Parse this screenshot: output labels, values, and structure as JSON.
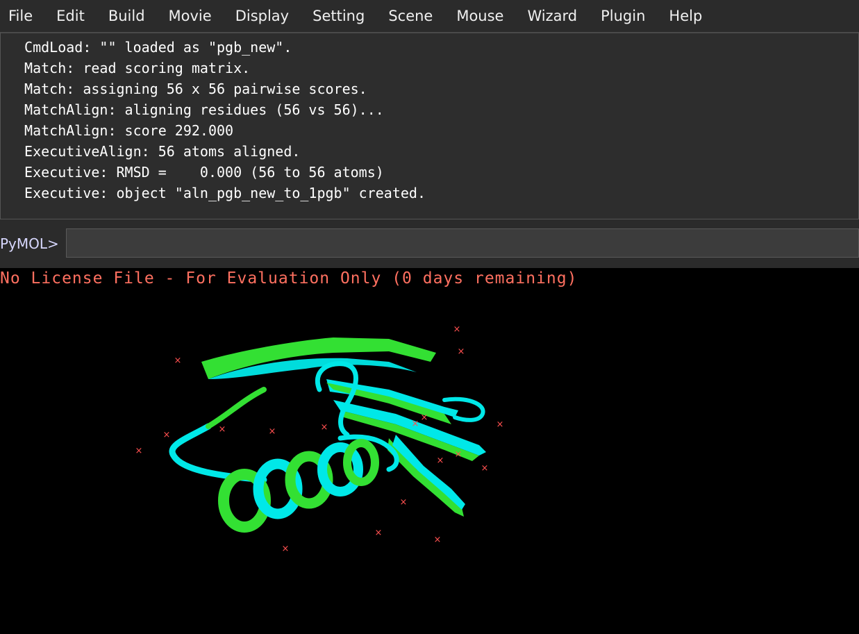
{
  "menubar": {
    "items": [
      {
        "label": "File"
      },
      {
        "label": "Edit"
      },
      {
        "label": "Build"
      },
      {
        "label": "Movie"
      },
      {
        "label": "Display"
      },
      {
        "label": "Setting"
      },
      {
        "label": "Scene"
      },
      {
        "label": "Mouse"
      },
      {
        "label": "Wizard"
      },
      {
        "label": "Plugin"
      },
      {
        "label": "Help"
      }
    ]
  },
  "console": {
    "lines": [
      " CmdLoad: \"\" loaded as \"pgb_new\".",
      " Match: read scoring matrix.",
      " Match: assigning 56 x 56 pairwise scores.",
      " MatchAlign: aligning residues (56 vs 56)...",
      " MatchAlign: score 292.000",
      " ExecutiveAlign: 56 atoms aligned.",
      " Executive: RMSD =    0.000 (56 to 56 atoms)",
      " Executive: object \"aln_pgb_new_to_1pgb\" created."
    ]
  },
  "command": {
    "prompt": "PyMOL>",
    "value": ""
  },
  "viewer": {
    "license_text": "No License File - For Evaluation Only (0 days remaining)",
    "colors": {
      "license": "#ff7060",
      "structure_a": "#00e8e8",
      "structure_b": "#33e033",
      "water_marker": "#ff5050",
      "background": "#000000"
    }
  }
}
